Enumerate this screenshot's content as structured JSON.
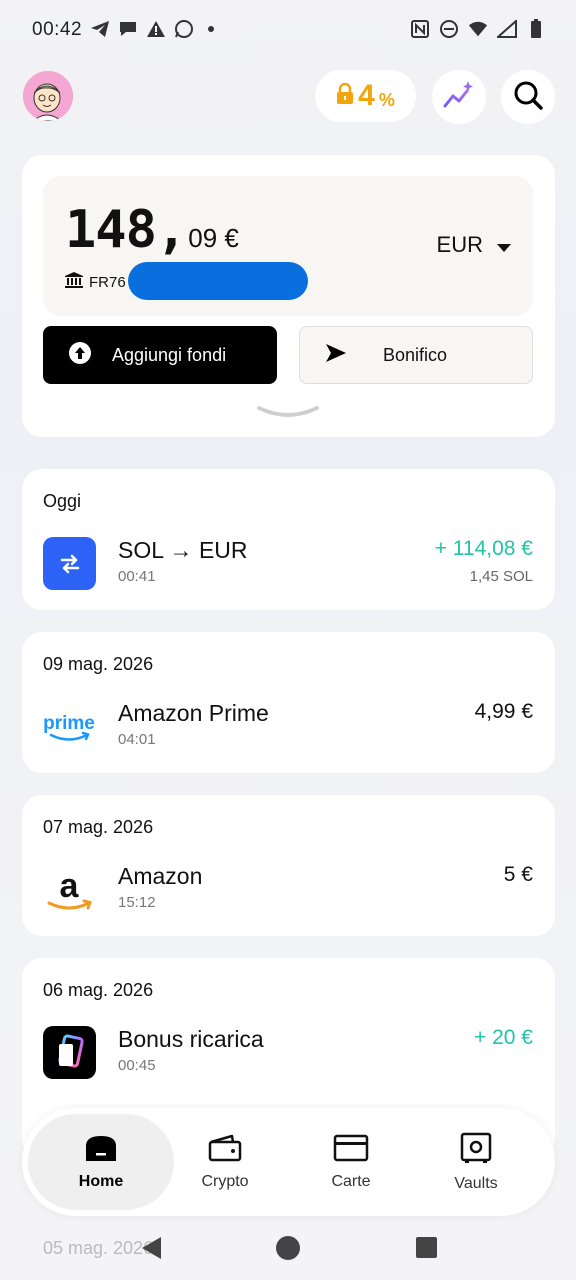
{
  "status_bar": {
    "time": "00:42",
    "left_icons": [
      "telegram-icon",
      "chat-bubble-icon",
      "warning-icon",
      "whatsapp-icon",
      "dot-icon"
    ],
    "right_icons": [
      "nfc-icon",
      "dnd-icon",
      "wifi-icon",
      "signal-icon",
      "battery-icon"
    ]
  },
  "header": {
    "rate_value": "4",
    "rate_unit": "%",
    "colors": {
      "rate": "#f2a50c",
      "avatar_bg": "#f4a7d2"
    }
  },
  "balance": {
    "integer": "148,",
    "decimal": "09 €",
    "iban_prefix": "FR76",
    "currency": "EUR",
    "add_funds_label": "Aggiungi fondi",
    "transfer_label": "Bonifico"
  },
  "transactions": [
    {
      "date": "Oggi",
      "title": "SOL → EUR",
      "time": "00:41",
      "amount": "+ 114,08 €",
      "sub": "1,45 SOL",
      "icon": "swap-icon",
      "positive": true
    },
    {
      "date": "09 mag. 2026",
      "title": "Amazon Prime",
      "time": "04:01",
      "amount": "4,99 €",
      "icon": "prime-logo",
      "logo_text": "prime",
      "positive": false
    },
    {
      "date": "07 mag. 2026",
      "title": "Amazon",
      "time": "15:12",
      "amount": "5 €",
      "icon": "amazon-logo",
      "logo_text": "a",
      "positive": false
    },
    {
      "date": "06 mag. 2026",
      "title": "Bonus ricarica",
      "time": "00:45",
      "amount": "+ 20 €",
      "icon": "card-gradient-icon",
      "positive": true
    }
  ],
  "peek_date": "05 mag. 2026",
  "nav": [
    {
      "label": "Home",
      "icon": "home-icon",
      "active": true
    },
    {
      "label": "Crypto",
      "icon": "wallet-icon",
      "active": false
    },
    {
      "label": "Carte",
      "icon": "card-icon",
      "active": false
    },
    {
      "label": "Vaults",
      "icon": "vault-icon",
      "active": false
    }
  ],
  "accent_colors": {
    "positive": "#23c4a5",
    "iban_mask": "#0a6fde",
    "swap_icon_bg": "#2d62f6"
  }
}
